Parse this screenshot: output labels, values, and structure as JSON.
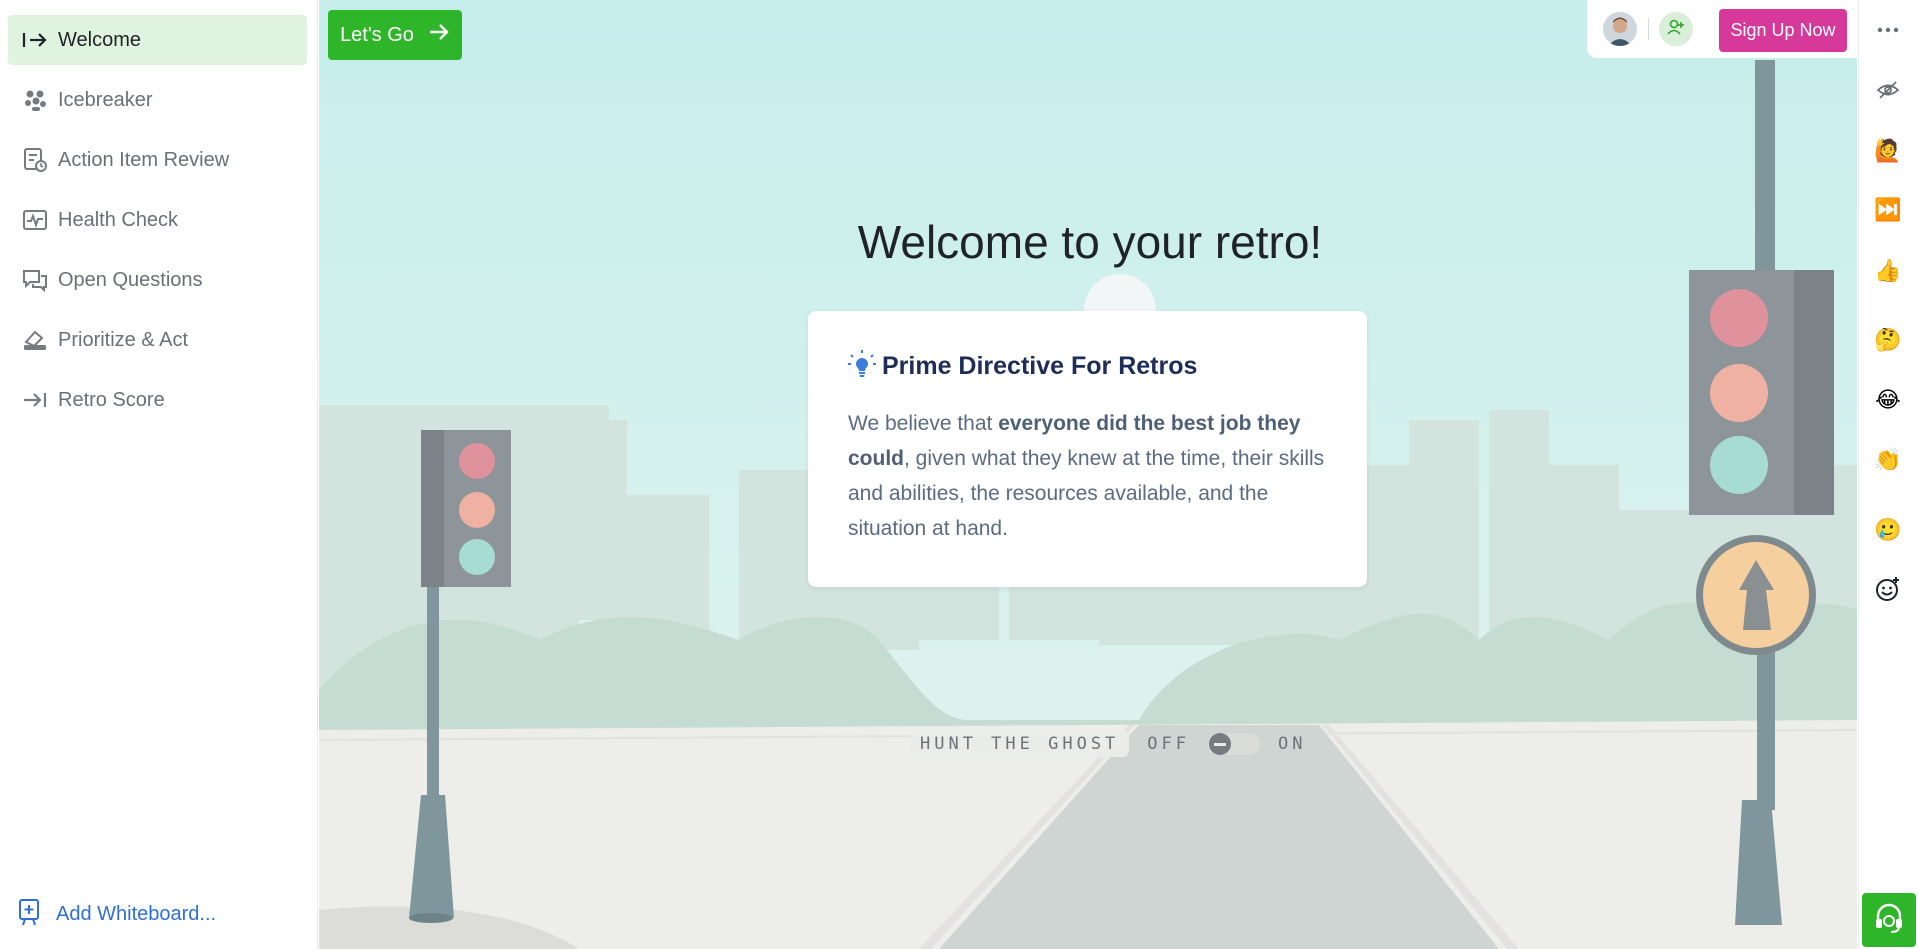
{
  "sidebar": {
    "items": [
      {
        "label": "Welcome",
        "icon": "arrow-right-from-bar-icon"
      },
      {
        "label": "Icebreaker",
        "icon": "icebreaker-icon"
      },
      {
        "label": "Action Item Review",
        "icon": "action-review-icon"
      },
      {
        "label": "Health Check",
        "icon": "health-check-icon"
      },
      {
        "label": "Open Questions",
        "icon": "chat-bubbles-icon"
      },
      {
        "label": "Prioritize & Act",
        "icon": "prioritize-icon"
      },
      {
        "label": "Retro Score",
        "icon": "arrow-to-bar-icon"
      }
    ],
    "active_index": 0,
    "add_whiteboard": "Add Whiteboard..."
  },
  "toolbar": {
    "lets_go": "Let's Go",
    "sign_up": "Sign Up Now"
  },
  "main": {
    "title": "Welcome to your retro!",
    "card": {
      "title": "Prime Directive For Retros",
      "body_pre": "We believe that ",
      "body_bold": "everyone did the best job they could",
      "body_post": ", given what they knew at the time, their skills and abilities, the resources available, and the situation at hand."
    },
    "ghost": {
      "label": "HUNT THE GHOST",
      "off": "OFF",
      "on": "ON",
      "enabled": false
    }
  },
  "rail": {
    "reactions": [
      "eye-off-icon",
      "raised-hand-emoji",
      "skip-forward-emoji",
      "thumbs-up-emoji",
      "thinking-emoji",
      "laughing-emoji",
      "clapping-emoji",
      "sad-emoji",
      "add-reaction-icon"
    ],
    "emoji": [
      "🙋",
      "⏭️",
      "👍",
      "🤔",
      "😂",
      "👏",
      "🥲"
    ]
  },
  "colors": {
    "accent_green": "#2fb52a",
    "signup_pink": "#d6399a",
    "active_nav_bg": "#dff3df",
    "link_blue": "#2f6fd6"
  }
}
